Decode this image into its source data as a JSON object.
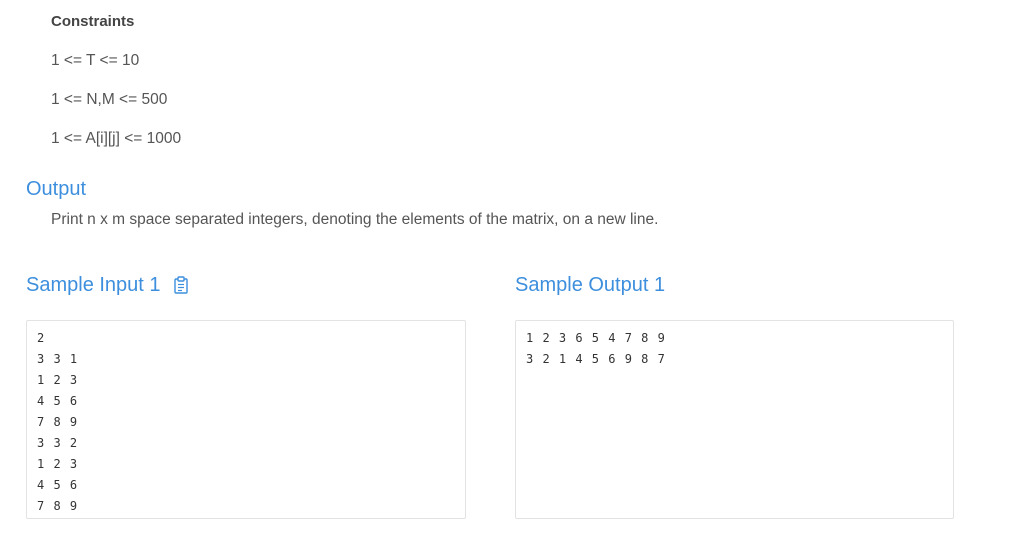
{
  "constraints": {
    "title": "Constraints",
    "lines": [
      "1 <= T <= 10",
      "1 <= N,M <= 500",
      "1 <= A[i][j] <= 1000"
    ]
  },
  "output": {
    "heading": "Output",
    "description": "Print n x m space separated integers, denoting the elements of the matrix, on a new line."
  },
  "sample_input": {
    "heading": "Sample Input 1",
    "copy_icon": "clipboard-icon",
    "lines": [
      "2",
      "3 3 1",
      "1 2 3",
      "4 5 6",
      "7 8 9",
      "3 3 2",
      "1 2 3",
      "4 5 6",
      "7 8 9"
    ]
  },
  "sample_output": {
    "heading": "Sample Output 1",
    "lines": [
      "1 2 3 6 5 4 7 8 9",
      "3 2 1 4 5 6 9 8 7"
    ]
  },
  "colors": {
    "accent": "#3d8fde",
    "text": "#555555",
    "border": "#e3e3e3"
  }
}
